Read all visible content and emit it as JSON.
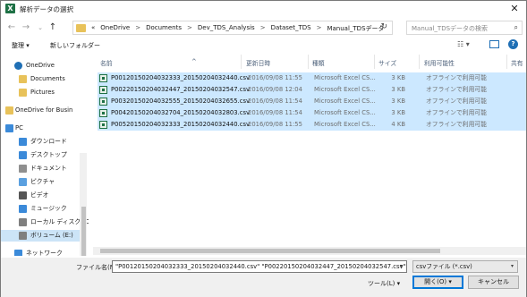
{
  "window": {
    "title": "解析データの選択",
    "app_icon_letter": "X",
    "close_symbol": "✕"
  },
  "address": {
    "back": "←",
    "forward": "→",
    "recent": "⌄",
    "up": "↑",
    "prefix": "«",
    "crumbs": [
      "OneDrive",
      "Documents",
      "Dev_TDS_Analysis",
      "Dataset_TDS",
      "Manual_TDSデータ"
    ],
    "separator": ">",
    "refresh": "↻"
  },
  "search": {
    "placeholder": "Manual_TDSデータの検索",
    "icon": "search-icon"
  },
  "toolbar": {
    "organize": "整理 ▾",
    "new_folder": "新しいフォルダー",
    "view_icon": "☷ ▾",
    "help": "?"
  },
  "nav": {
    "items": [
      {
        "label": "OneDrive",
        "icon": "cloud-icon",
        "color": "#1f6fb5"
      },
      {
        "label": "Documents",
        "icon": "folder-icon",
        "color": "#e8c25a"
      },
      {
        "label": "Pictures",
        "icon": "folder-icon",
        "color": "#e8c25a"
      },
      {
        "label": "OneDrive for Busin",
        "icon": "folder-icon",
        "color": "#e8c25a"
      },
      {
        "label": "PC",
        "icon": "pc-icon",
        "color": "#3b8ad9"
      },
      {
        "label": "ダウンロード",
        "icon": "download-icon",
        "color": "#3b8ad9"
      },
      {
        "label": "デスクトップ",
        "icon": "desktop-icon",
        "color": "#3b8ad9"
      },
      {
        "label": "ドキュメント",
        "icon": "documents-icon",
        "color": "#8f8f8f"
      },
      {
        "label": "ピクチャ",
        "icon": "pictures-icon",
        "color": "#5aa0e0"
      },
      {
        "label": "ビデオ",
        "icon": "video-icon",
        "color": "#555555"
      },
      {
        "label": "ミュージック",
        "icon": "music-icon",
        "color": "#3b8ad9"
      },
      {
        "label": "ローカル ディスク (C",
        "icon": "drive-icon",
        "color": "#7f7f7f"
      },
      {
        "label": "ボリューム (E:)",
        "icon": "drive-icon",
        "color": "#7f7f7f"
      },
      {
        "label": "ネットワーク",
        "icon": "network-icon",
        "color": "#3b8ad9"
      }
    ]
  },
  "columns": {
    "name": "名前",
    "modified": "更新日時",
    "type": "種類",
    "size": "サイズ",
    "availability": "利用可能性",
    "shared": "共有"
  },
  "files": [
    {
      "name": "P00120150204032333_20150204032440.csv",
      "modified": "2016/09/08 11:55",
      "type": "Microsoft Excel CS...",
      "size": "3 KB",
      "availability": "オフラインで利用可能"
    },
    {
      "name": "P00220150204032447_20150204032547.csv",
      "modified": "2016/09/08 12:04",
      "type": "Microsoft Excel CS...",
      "size": "3 KB",
      "availability": "オフラインで利用可能"
    },
    {
      "name": "P00320150204032555_20150204032655.csv",
      "modified": "2016/09/08 11:54",
      "type": "Microsoft Excel CS...",
      "size": "3 KB",
      "availability": "オフラインで利用可能"
    },
    {
      "name": "P00420150204032704_20150204032803.csv",
      "modified": "2016/09/08 11:54",
      "type": "Microsoft Excel CS...",
      "size": "3 KB",
      "availability": "オフラインで利用可能"
    },
    {
      "name": "P00520150204032333_20150204032440.csv",
      "modified": "2016/09/08 11:55",
      "type": "Microsoft Excel CS...",
      "size": "4 KB",
      "availability": "オフラインで利用可能"
    }
  ],
  "footer": {
    "filename_label": "ファイル名(N):",
    "filename_value": "\"P00120150204032333_20150204032440.csv\" \"P00220150204032447_20150204032547.csv\" \"P0032C",
    "filter": "csvファイル (*.csv)",
    "tools": "ツール(L) ▾",
    "open": "開く(O)",
    "open_dd": "▾",
    "cancel": "キャンセル"
  },
  "colors": {
    "selection": "#cce8ff",
    "accent": "#0078d7",
    "excel": "#1e7145"
  }
}
